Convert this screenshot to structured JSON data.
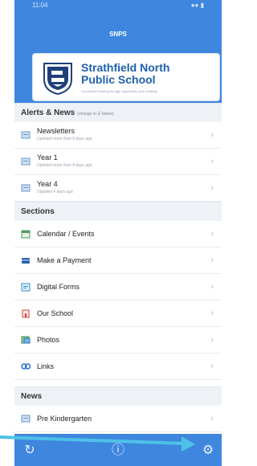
{
  "status": {
    "time": "11:04",
    "indicators": "●● ▮"
  },
  "app": {
    "title": "SNPS"
  },
  "school": {
    "name_line1": "Strathfield North",
    "name_line2": "Public School",
    "motto": "Successful learning through opportunity and creativity"
  },
  "sections": {
    "alerts": {
      "header": "Alerts & News",
      "hint": "(change in ☰ below)",
      "items": [
        {
          "title": "Newsletters",
          "subtitle": "Updated more than 8 days ago",
          "icon": "newsletter-icon"
        },
        {
          "title": "Year 1",
          "subtitle": "Updated more than 8 days ago",
          "icon": "newsletter-icon"
        },
        {
          "title": "Year 4",
          "subtitle": "Updated 4 days ago",
          "icon": "newsletter-icon"
        }
      ]
    },
    "sections": {
      "header": "Sections",
      "items": [
        {
          "title": "Calendar / Events",
          "icon": "calendar-icon"
        },
        {
          "title": "Make a Payment",
          "icon": "payment-icon"
        },
        {
          "title": "Digital Forms",
          "icon": "forms-icon"
        },
        {
          "title": "Our School",
          "icon": "school-icon"
        },
        {
          "title": "Photos",
          "icon": "photos-icon"
        },
        {
          "title": "Links",
          "icon": "links-icon"
        }
      ]
    },
    "news": {
      "header": "News",
      "items": [
        {
          "title": "Pre Kindergarten",
          "icon": "newsletter-icon"
        }
      ]
    }
  },
  "tabbar": {
    "refresh_icon": "↻",
    "info_icon": "ⓘ",
    "settings_icon": "⚙"
  },
  "colors": {
    "brand_blue": "#3f86df",
    "arrow": "#4fc1e8"
  }
}
